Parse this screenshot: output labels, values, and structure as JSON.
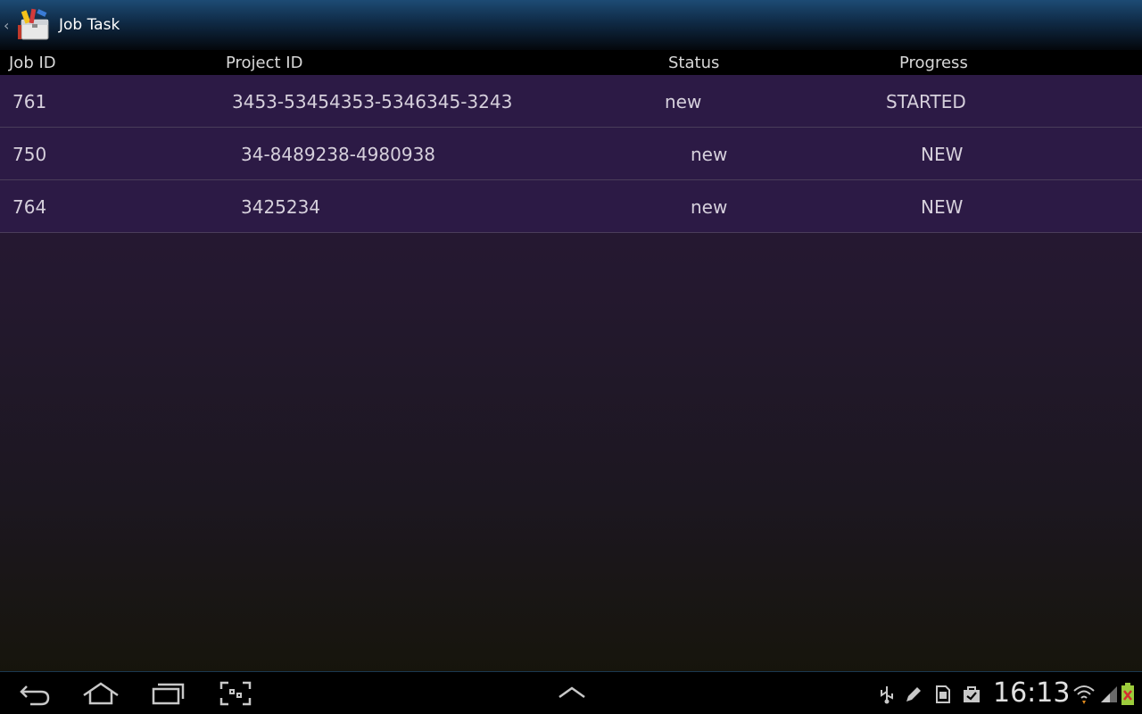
{
  "app": {
    "title": "Job Task",
    "icon": "toolbox-app-icon",
    "up_icon": "chevron-left-icon"
  },
  "table": {
    "headers": {
      "job_id": "Job ID",
      "project_id": "Project ID",
      "status": "Status",
      "progress": "Progress"
    },
    "rows": [
      {
        "job_id": "761",
        "project_id": "3453-53454353-5346345-3243",
        "status": "new",
        "progress": "STARTED"
      },
      {
        "job_id": "750",
        "project_id": "34-8489238-4980938",
        "status": "new",
        "progress": "NEW"
      },
      {
        "job_id": "764",
        "project_id": "3425234",
        "status": "new",
        "progress": "NEW"
      }
    ]
  },
  "system_bar": {
    "nav_icons": [
      "back-icon",
      "home-icon",
      "recent-apps-icon",
      "screenshot-icon",
      "chevron-up-icon"
    ],
    "status_icons": [
      "usb-icon",
      "pen-icon",
      "sd-card-icon",
      "shopping-bag-icon",
      "wifi-icon",
      "signal-icon",
      "battery-icon"
    ],
    "clock": "16:13"
  },
  "colors": {
    "action_bar": "#1d4b74",
    "row_background": "#2c1a45",
    "text": "#d6d0dc"
  }
}
